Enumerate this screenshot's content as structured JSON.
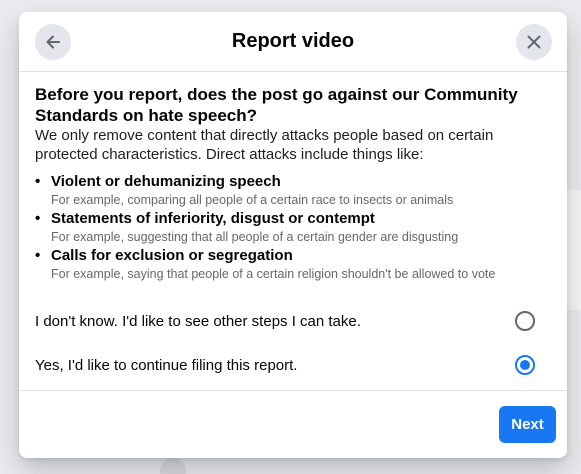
{
  "dialog": {
    "title": "Report video",
    "back_icon": "arrow-left-icon",
    "close_icon": "close-icon",
    "question": "Before you report, does the post go against our Community Standards on hate speech?",
    "intro": "We only remove content that directly attacks people based on certain protected characteristics. Direct attacks include things like:",
    "bullets": [
      {
        "title": "Violent or dehumanizing speech",
        "desc": "For example, comparing all people of a certain race to insects or animals"
      },
      {
        "title": "Statements of inferiority, disgust or contempt",
        "desc": "For example, suggesting that all people of a certain gender are disgusting"
      },
      {
        "title": "Calls for exclusion or segregation",
        "desc": "For example, saying that people of a certain religion shouldn't be allowed to vote"
      }
    ],
    "options": [
      {
        "label": "I don't know. I'd like to see other steps I can take.",
        "selected": false
      },
      {
        "label": "Yes, I'd like to continue filing this report.",
        "selected": true
      }
    ],
    "next_label": "Next"
  },
  "colors": {
    "accent": "#1877f2",
    "secondary_text": "#65676b",
    "button_gray": "#e4e6eb"
  }
}
